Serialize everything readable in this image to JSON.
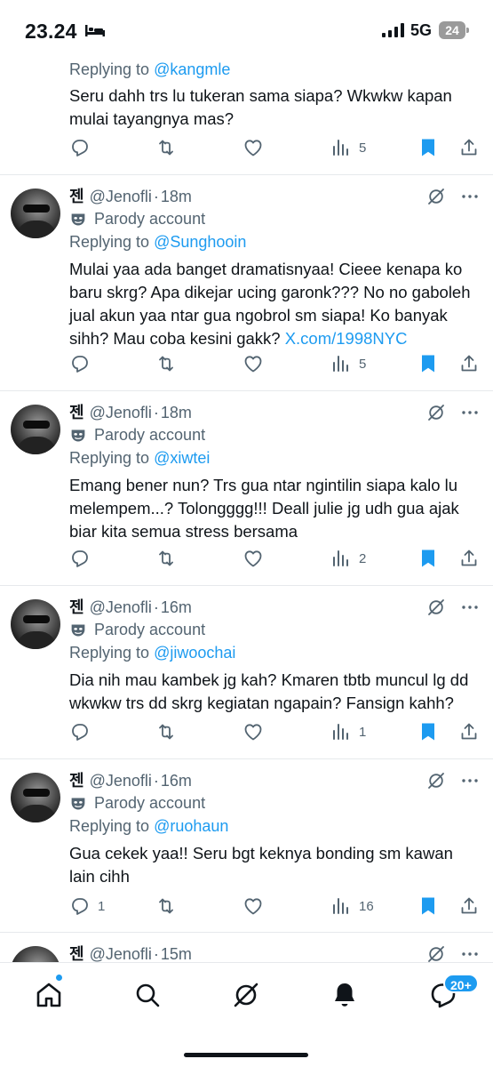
{
  "status_bar": {
    "time": "23.24",
    "network": "5G",
    "battery": "24"
  },
  "posts": [
    {
      "partial_top": true,
      "replying_prefix": "Replying to",
      "replying_to": "@kangmle",
      "text": "Seru dahh trs lu tukeran sama siapa? Wkwkw kapan mulai tayangnya mas?",
      "counts": {
        "replies": "",
        "reposts": "",
        "likes": "",
        "views": "5"
      }
    },
    {
      "name": "젠",
      "handle": "@Jenofli",
      "time": "18m",
      "parody": "Parody account",
      "replying_prefix": "Replying to",
      "replying_to": "@Sunghooin",
      "text": "Mulai yaa ada banget dramatisnyaa! Cieee kenapa ko baru skrg? Apa dikejar ucing garonk??? No no gaboleh jual akun yaa ntar gua ngobrol sm siapa! Ko banyak sihh? Mau coba kesini gakk?",
      "link": "X.com/1998NYC",
      "counts": {
        "replies": "",
        "reposts": "",
        "likes": "",
        "views": "5"
      }
    },
    {
      "name": "젠",
      "handle": "@Jenofli",
      "time": "18m",
      "parody": "Parody account",
      "replying_prefix": "Replying to",
      "replying_to": "@xiwtei",
      "text": "Emang bener nun? Trs gua ntar ngintilin siapa kalo lu melempem...? Tolongggg!!! Deall julie jg udh gua ajak biar kita semua stress bersama",
      "counts": {
        "replies": "",
        "reposts": "",
        "likes": "",
        "views": "2"
      }
    },
    {
      "name": "젠",
      "handle": "@Jenofli",
      "time": "16m",
      "parody": "Parody account",
      "replying_prefix": "Replying to",
      "replying_to": "@jiwoochai",
      "text": "Dia nih mau kambek jg kah? Kmaren tbtb muncul lg dd wkwkw trs dd skrg kegiatan ngapain? Fansign kahh?",
      "counts": {
        "replies": "",
        "reposts": "",
        "likes": "",
        "views": "1"
      }
    },
    {
      "name": "젠",
      "handle": "@Jenofli",
      "time": "16m",
      "parody": "Parody account",
      "replying_prefix": "Replying to",
      "replying_to": "@ruohaun",
      "text": "Gua cekek yaa!! Seru bgt keknya bonding sm kawan lain cihh",
      "counts": {
        "replies": "1",
        "reposts": "",
        "likes": "",
        "views": "16"
      }
    },
    {
      "name": "젠",
      "handle": "@Jenofli",
      "time": "15m"
    }
  ],
  "tabbar": {
    "messages_badge": "20+"
  },
  "colors": {
    "accent": "#1d9bf0",
    "secondary_text": "#536471",
    "primary_text": "#0f1419",
    "divider": "#e6e9ec"
  },
  "icons": [
    "reply-icon",
    "repost-icon",
    "like-icon",
    "views-icon",
    "bookmark-icon",
    "share-icon",
    "grok-icon",
    "more-icon",
    "parody-mask-icon",
    "home-icon",
    "search-icon",
    "grok-tab-icon",
    "notifications-icon",
    "messages-icon"
  ]
}
